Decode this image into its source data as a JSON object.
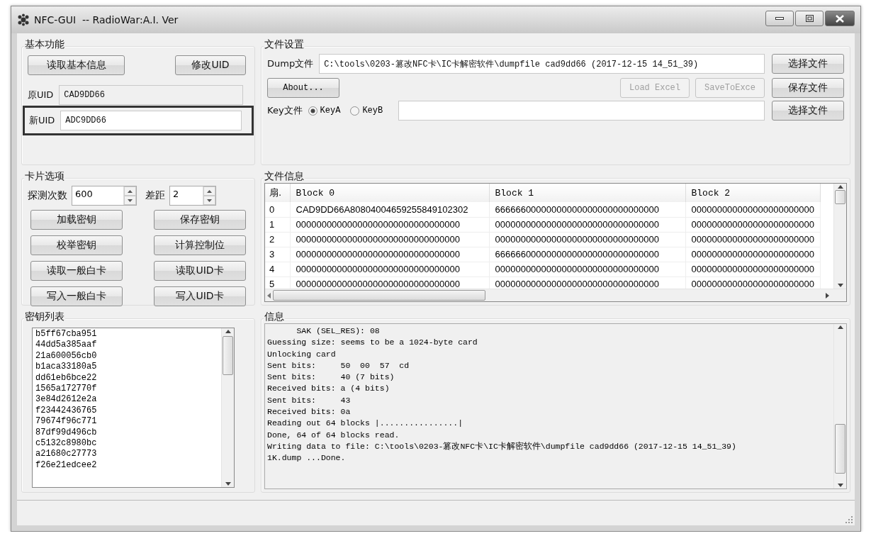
{
  "window": {
    "title": "NFC-GUI  -- RadioWar:A.I. Ver"
  },
  "basic": {
    "title": "基本功能",
    "buttons": [
      {
        "label": "读取基本信息"
      },
      {
        "label": "修改UID"
      }
    ],
    "fields": [
      {
        "label": "原UID",
        "value": "CAD9DD66",
        "readonly": true,
        "highlighted": false
      },
      {
        "label": "新UID",
        "value": "ADC9DD66",
        "readonly": false,
        "highlighted": true
      }
    ]
  },
  "file_settings": {
    "title": "文件设置",
    "dump": {
      "label": "Dump文件",
      "value": "C:\\tools\\0203-篡改NFC卡\\IC卡解密软件\\dumpfile cad9dd66 (2017-12-15 14_51_39)"
    },
    "dump_button": "选择文件",
    "about": "About...",
    "actions": [
      {
        "label": "Load Excel",
        "disabled": true
      },
      {
        "label": "SaveToExce",
        "disabled": true
      }
    ],
    "save_button": "保存文件",
    "key": {
      "label": "Key文件",
      "options": [
        {
          "label": "KeyA",
          "selected": true
        },
        {
          "label": "KeyB",
          "selected": false
        }
      ]
    },
    "key_button": "选择文件"
  },
  "card_options": {
    "title": "卡片选项",
    "spinners": [
      {
        "label": "探测次数",
        "value": "600"
      },
      {
        "label": "差距",
        "value": "2"
      }
    ],
    "buttons": [
      "加载密钥",
      "保存密钥",
      "校举密钥",
      "计算控制位",
      "读取一般白卡",
      "读取UID卡",
      "写入一般白卡",
      "写入UID卡"
    ]
  },
  "file_info": {
    "title": "文件信息",
    "columns": [
      "扇.",
      "Block 0",
      "Block 1",
      "Block 2"
    ],
    "rows": [
      [
        "0",
        "CAD9DD66A80804004659255849102302",
        "66666600000000000000000000000000",
        "000000000000000000000000"
      ],
      [
        "1",
        "00000000000000000000000000000000",
        "00000000000000000000000000000000",
        "000000000000000000000000"
      ],
      [
        "2",
        "00000000000000000000000000000000",
        "00000000000000000000000000000000",
        "000000000000000000000000"
      ],
      [
        "3",
        "00000000000000000000000000000000",
        "66666600000000000000000000000000",
        "000000000000000000000000"
      ],
      [
        "4",
        "00000000000000000000000000000000",
        "00000000000000000000000000000000",
        "000000000000000000000000"
      ],
      [
        "5",
        "00000000000000000000000000000000",
        "00000000000000000000000000000000",
        "000000000000000000000000"
      ]
    ]
  },
  "key_list": {
    "title": "密钥列表",
    "items": [
      "b5ff67cba951",
      "44dd5a385aaf",
      "21a600056cb0",
      "b1aca33180a5",
      "dd61eb6bce22",
      "1565a172770f",
      "3e84d2612e2a",
      "f23442436765",
      "79674f96c771",
      "87df99d496cb",
      "c5132c8980bc",
      "a21680c27773",
      "f26e21edcee2"
    ]
  },
  "info": {
    "title": "信息",
    "lines": [
      "      SAK (SEL_RES): 08",
      "Guessing size: seems to be a 1024-byte card",
      "Unlocking card",
      "Sent bits:     50  00  57  cd",
      "Sent bits:     40 (7 bits)",
      "Received bits: a (4 bits)",
      "Sent bits:     43",
      "Received bits: 0a",
      "Reading out 64 blocks |................|",
      "Done, 64 of 64 blocks read.",
      "Writing data to file: C:\\tools\\0203-篡改NFC卡\\IC卡解密软件\\dumpfile cad9dd66 (2017-12-15 14_51_39)",
      "1K.dump ...Done."
    ]
  }
}
